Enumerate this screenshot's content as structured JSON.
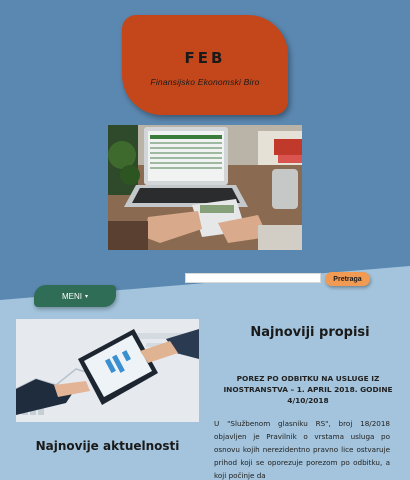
{
  "logo": {
    "title": "FEB",
    "subtitle": "Finansijsko Ekonomski Biro"
  },
  "search": {
    "placeholder": "",
    "button_label": "Pretraga"
  },
  "menu": {
    "label": "MENI",
    "arrow": "▾"
  },
  "latest_regulations": {
    "heading": "Najnoviji propisi",
    "article_title": "POREZ PO ODBITKU NA USLUGE IZ INOSTRANSTVA – 1. APRIL 2018. GODINE 4/10/2018",
    "article_body": "U \"Službenom glasniku RS\", broj 18/2018 objavljen je Pravilnik o vrstama usluga po osnovu kojih nerezidentno pravno lice ostvaruje prihod koji se oporezuje porezom po odbitku, a koji počinje da"
  },
  "latest_news": {
    "heading": "Najnovije aktuelnosti"
  },
  "colors": {
    "page_background": "#5b88b1",
    "lower_background": "#a3c4dc",
    "logo_background": "#c4471b",
    "menu_button": "#2f6d56",
    "search_button": "#f09a54"
  }
}
